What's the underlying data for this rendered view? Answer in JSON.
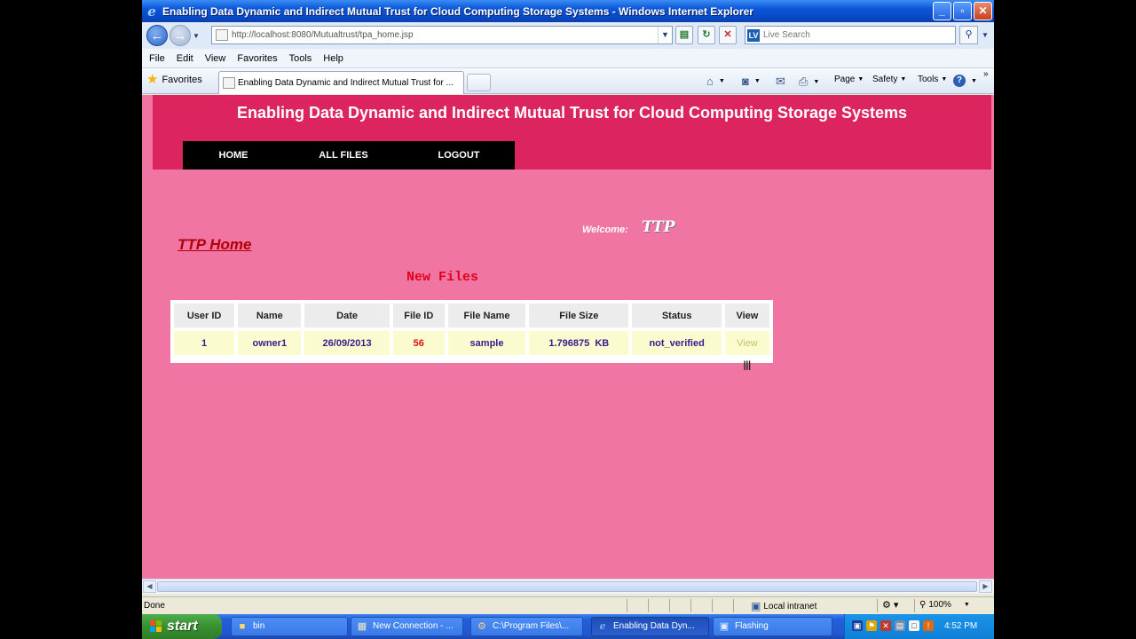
{
  "window": {
    "title": "Enabling Data Dynamic and Indirect Mutual Trust for Cloud Computing Storage Systems - Windows Internet Explorer",
    "controls": [
      "_",
      "▫",
      "✕"
    ]
  },
  "address": {
    "url": "http://localhost:8080/Mutualtrust/tpa_home.jsp"
  },
  "search": {
    "placeholder": "Live Search",
    "provider_badge": "LV"
  },
  "menu": [
    "File",
    "Edit",
    "View",
    "Favorites",
    "Tools",
    "Help"
  ],
  "tabs_bar": {
    "favorites_label": "Favorites",
    "tab_title": "Enabling Data Dynamic and Indirect Mutual Trust for ...",
    "commands": [
      {
        "label": "",
        "icon": "home-icon",
        "glyph": "⌂"
      },
      {
        "label": "",
        "icon": "feeds-icon",
        "glyph": "◙"
      },
      {
        "label": "",
        "icon": "mail-icon",
        "glyph": "✉"
      },
      {
        "label": "",
        "icon": "print-icon",
        "glyph": "⎙"
      },
      {
        "label": "Page",
        "icon": "",
        "glyph": ""
      },
      {
        "label": "Safety",
        "icon": "",
        "glyph": ""
      },
      {
        "label": "Tools",
        "icon": "",
        "glyph": ""
      },
      {
        "label": "",
        "icon": "help-icon",
        "glyph": "?"
      }
    ]
  },
  "page": {
    "site_title": "Enabling Data Dynamic and Indirect Mutual Trust for Cloud Computing Storage Systems",
    "nav": [
      "HOME",
      "ALL FILES",
      "LOGOUT"
    ],
    "welcome_label": "Welcome:",
    "welcome_user": "TTP",
    "heading": "TTP Home",
    "section_title": "New Files",
    "table": {
      "headers": [
        "User ID",
        "Name",
        "Date",
        "File ID",
        "File Name",
        "File Size",
        "Status",
        "View"
      ],
      "rows": [
        [
          "1",
          "owner1",
          "26/09/2013",
          "56",
          "sample",
          "1.796875  KB",
          "not_verified",
          "View"
        ]
      ]
    }
  },
  "statusbar": {
    "status": "Done",
    "zone": "Local intranet",
    "zoom": "100%"
  },
  "taskbar": {
    "start": "start",
    "tasks": [
      {
        "label": "bin",
        "icon": "folder-icon"
      },
      {
        "label": "New Connection - ...",
        "icon": "db-icon"
      },
      {
        "label": "C:\\Program Files\\...",
        "icon": "console-icon"
      },
      {
        "label": "Enabling Data Dyn...",
        "icon": "ie-icon"
      },
      {
        "label": "Flashing",
        "icon": "app-icon"
      }
    ],
    "clock": "4:52 PM"
  },
  "colors": {
    "page_bg": "#f075a3",
    "header_bg": "#dc245e",
    "nav_bg": "#000000",
    "heading": "#b00000",
    "section_title": "#e3001b"
  }
}
